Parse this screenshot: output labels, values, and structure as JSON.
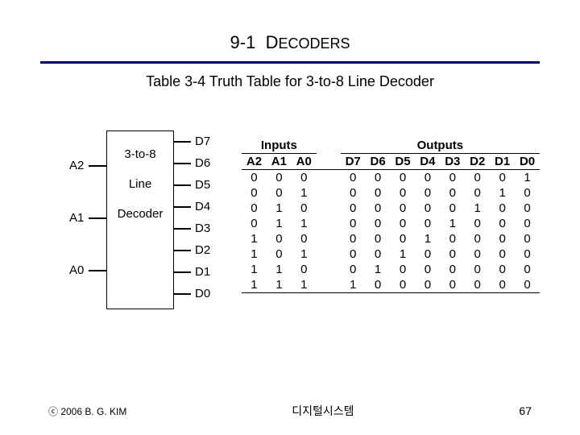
{
  "title": {
    "section": "9-1",
    "word": "D",
    "rest": "ECODERS"
  },
  "caption": "Table 3-4  Truth Table for 3-to-8 Line Decoder",
  "diagram": {
    "inputs": [
      "A2",
      "A1",
      "A0"
    ],
    "box": [
      "3-to-8",
      "Line",
      "Decoder"
    ],
    "outputs": [
      "D7",
      "D6",
      "D5",
      "D4",
      "D3",
      "D2",
      "D1",
      "D0"
    ]
  },
  "table": {
    "inHeader": "Inputs",
    "outHeader": "Outputs",
    "inCols": [
      "A2",
      "A1",
      "A0"
    ],
    "outCols": [
      "D7",
      "D6",
      "D5",
      "D4",
      "D3",
      "D2",
      "D1",
      "D0"
    ],
    "rows": [
      {
        "in": [
          0,
          0,
          0
        ],
        "out": [
          0,
          0,
          0,
          0,
          0,
          0,
          0,
          1
        ]
      },
      {
        "in": [
          0,
          0,
          1
        ],
        "out": [
          0,
          0,
          0,
          0,
          0,
          0,
          1,
          0
        ]
      },
      {
        "in": [
          0,
          1,
          0
        ],
        "out": [
          0,
          0,
          0,
          0,
          0,
          1,
          0,
          0
        ]
      },
      {
        "in": [
          0,
          1,
          1
        ],
        "out": [
          0,
          0,
          0,
          0,
          1,
          0,
          0,
          0
        ]
      },
      {
        "in": [
          1,
          0,
          0
        ],
        "out": [
          0,
          0,
          0,
          1,
          0,
          0,
          0,
          0
        ]
      },
      {
        "in": [
          1,
          0,
          1
        ],
        "out": [
          0,
          0,
          1,
          0,
          0,
          0,
          0,
          0
        ]
      },
      {
        "in": [
          1,
          1,
          0
        ],
        "out": [
          0,
          1,
          0,
          0,
          0,
          0,
          0,
          0
        ]
      },
      {
        "in": [
          1,
          1,
          1
        ],
        "out": [
          1,
          0,
          0,
          0,
          0,
          0,
          0,
          0
        ]
      }
    ]
  },
  "footer": {
    "left": "ⓒ 2006  B. G. KIM",
    "center": "디지털시스템",
    "right": "67"
  }
}
